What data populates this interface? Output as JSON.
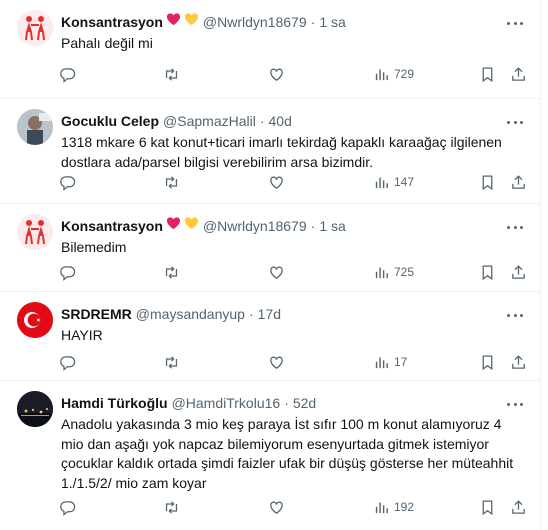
{
  "tweets": [
    {
      "name": "Konsantrasyon",
      "emoji": [
        "red-heart",
        "yellow-heart"
      ],
      "handle": "@Nwrldyn18679",
      "time": "1 sa",
      "text": "Pahalı değil mi",
      "views": "729"
    },
    {
      "name": "Gocuklu Celep",
      "handle": "@SapmazHalil",
      "time": "40d",
      "text": "1318 mkare 6 kat konut+ticari imarlı tekirdağ kapaklı karaağaç ilgilenen dostlara ada/parsel bilgisi verebilirim arsa bizimdir.",
      "views": "147"
    },
    {
      "name": "Konsantrasyon",
      "emoji": [
        "red-heart",
        "yellow-heart"
      ],
      "handle": "@Nwrldyn18679",
      "time": "1 sa",
      "text": "Bilemedim",
      "views": "725"
    },
    {
      "name": "SRDREMR",
      "handle": "@maysandanyup",
      "time": "17d",
      "text": "HAYIR",
      "views": "17"
    },
    {
      "name": "Hamdi Türkoğlu",
      "handle": "@HamdiTrkolu16",
      "time": "52d",
      "text": "Anadolu yakasında 3 mio keş paraya İst sıfır 100 m konut alamıyoruz 4 mio dan aşağı yok  napcaz bilemiyorum esenyurtada gitmek istemiyor çocuklar kaldık ortada şimdi faizler ufak bir düşüş gösterse her müteahhit 1./1.5/2/ mio zam koyar",
      "views": "192"
    }
  ],
  "separator": "·",
  "colors": {
    "text": "#0f1419",
    "secondary": "#536471",
    "border": "#eff3f4",
    "heart_red": "#e0245e",
    "heart_yellow": "#ffc83d",
    "flag_red": "#e30a17"
  }
}
